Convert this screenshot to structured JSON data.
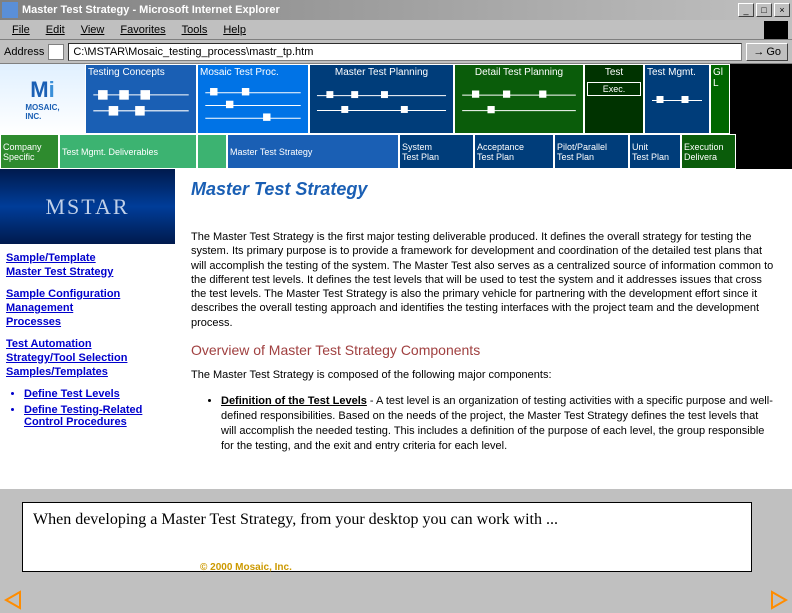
{
  "window": {
    "title": "Master Test Strategy - Microsoft Internet Explorer"
  },
  "menu": {
    "items": [
      "File",
      "Edit",
      "View",
      "Favorites",
      "Tools",
      "Help"
    ]
  },
  "address": {
    "label": "Address",
    "value": "C:\\MSTAR\\Mosaic_testing_process\\mastr_tp.htm",
    "go": "Go"
  },
  "navrow1": [
    {
      "label": "Testing Concepts"
    },
    {
      "label": "Mosaic Test Proc."
    },
    {
      "label": "Master Test Planning"
    },
    {
      "label": "Detail Test Planning"
    },
    {
      "label": "Test"
    },
    {
      "label": "Test Mgmt."
    },
    {
      "label": "Gl L"
    }
  ],
  "navrow1b": {
    "exec": "Exec."
  },
  "navrow2": [
    {
      "line1": "Company",
      "line2": "Specific"
    },
    {
      "line1": "Test Mgmt. Deliverables",
      "line2": ""
    },
    {
      "line1": "",
      "line2": ""
    },
    {
      "line1": "Master Test Strategy",
      "line2": ""
    },
    {
      "line1": "System",
      "line2": "Test Plan"
    },
    {
      "line1": "Acceptance",
      "line2": "Test Plan"
    },
    {
      "line1": "Pilot/Parallel",
      "line2": "Test Plan"
    },
    {
      "line1": "Unit",
      "line2": "Test Plan"
    },
    {
      "line1": "Execution",
      "line2": "Delivera"
    },
    {
      "line1": "",
      "line2": ""
    }
  ],
  "sidebar": {
    "logo": "MSTAR",
    "links": [
      [
        "Sample/Template",
        "Master Test Strategy"
      ],
      [
        "Sample Configuration",
        "Management",
        "Processes"
      ],
      [
        "Test Automation",
        "Strategy/Tool Selection",
        "Samples/Templates"
      ]
    ],
    "bullets": [
      "Define Test Levels",
      "Define Testing-Related Control Procedures"
    ]
  },
  "main": {
    "h1": "Master Test Strategy",
    "p1": "The Master Test Strategy is the first major testing deliverable produced.  It defines the overall strategy for testing the system.  Its primary purpose is to provide a framework for development and coordination of the detailed test plans that will accomplish the testing of the system.  The Master Test also serves as a centralized source of information common to the different test levels.  It defines the test levels that will be used to test the system and it addresses issues that cross the test levels.  The Master Test Strategy is also the primary vehicle for partnering with the development effort since it describes the overall testing approach and identifies the testing interfaces with the project team and the development process.",
    "h2": "Overview of Master Test Strategy Components",
    "p2": "The Master Test Strategy is composed of the following major components:",
    "li1_b": "Definition of the Test Levels",
    "li1_t": " - A test level is an organization of testing activities with a specific purpose and well-defined responsibilities.  Based on the needs of the project, the Master Test Strategy defines the test levels that will accomplish the needed testing.  This includes a definition of the purpose of each level, the group responsible for the testing, and the exit and entry criteria for each level."
  },
  "overlay": {
    "text": "When developing a Master Test Strategy, from your desktop you can work with ..."
  },
  "copyright": "© 2000 Mosaic, Inc."
}
